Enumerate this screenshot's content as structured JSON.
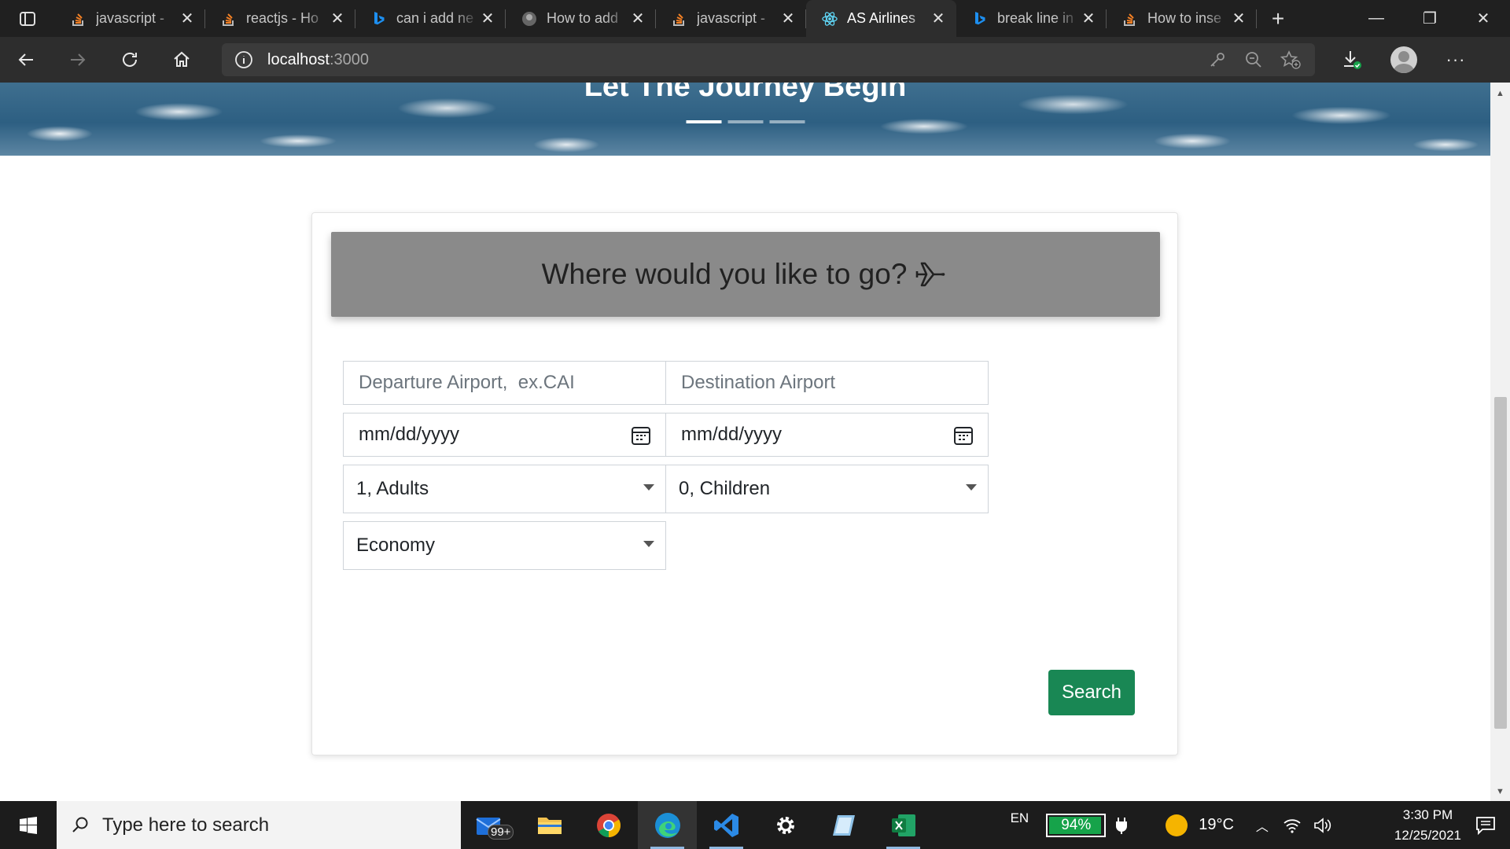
{
  "browser": {
    "tabs": [
      {
        "title": "javascript -",
        "favicon": "stackoverflow-icon",
        "active": false
      },
      {
        "title": "reactjs - Ho",
        "favicon": "stackoverflow-icon",
        "active": false
      },
      {
        "title": "can i add ne",
        "favicon": "bing-icon",
        "active": false
      },
      {
        "title": "How to add",
        "favicon": "avatar-icon",
        "active": false
      },
      {
        "title": "javascript -",
        "favicon": "stackoverflow-icon",
        "active": false
      },
      {
        "title": "AS Airlines",
        "favicon": "react-icon",
        "active": true
      },
      {
        "title": "break line in",
        "favicon": "bing-icon",
        "active": false
      },
      {
        "title": "How to inse",
        "favicon": "stackoverflow-icon",
        "active": false
      }
    ],
    "address": {
      "host": "localhost",
      "port": ":3000"
    }
  },
  "hero": {
    "title": "Let The Journey Begin"
  },
  "booking": {
    "heading": "Where would you like to go?",
    "departure_placeholder": "Departure Airport,  ex.CAI",
    "destination_placeholder": "Destination Airport",
    "depart_date_placeholder": "mm/dd/yyyy",
    "return_date_placeholder": "mm/dd/yyyy",
    "adults_value": "1, Adults",
    "children_value": "0, Children",
    "cabin_value": "Economy",
    "search_label": "Search"
  },
  "taskbar": {
    "search_placeholder": "Type here to search",
    "mail_badge": "99+",
    "language": "EN",
    "battery": "94%",
    "temperature": "19°C",
    "time": "3:30 PM",
    "date": "12/25/2021"
  },
  "colors": {
    "search_button": "#198754",
    "card_header": "#8a8a8a",
    "battery_fill": "#16a34a"
  }
}
